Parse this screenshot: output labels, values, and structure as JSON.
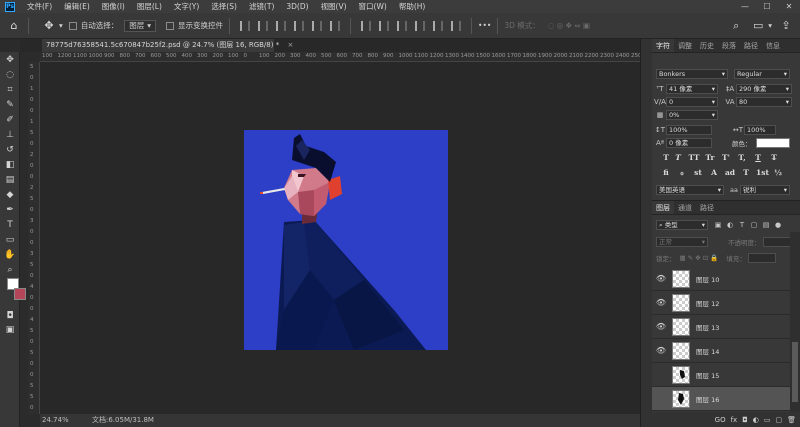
{
  "app": {
    "logo": "Ps"
  },
  "menu": [
    "文件(F)",
    "编辑(E)",
    "图像(I)",
    "图层(L)",
    "文字(Y)",
    "选择(S)",
    "滤镜(T)",
    "3D(D)",
    "视图(V)",
    "窗口(W)",
    "帮助(H)"
  ],
  "window_buttons": [
    "—",
    "☐",
    "✕"
  ],
  "options": {
    "auto_select_label": "自动选择：",
    "auto_select_value": "图层",
    "show_transform_label": "显示变换控件",
    "mode_3d_label": "3D 模式：",
    "more": "•••"
  },
  "document": {
    "tab_title": "78775d76358541.5c670847b25f2.psd @ 24.7% (图层 16, RGB/8) *",
    "zoom": "24.74%",
    "doc_info": "文档:6.05M/31.8M"
  },
  "ruler": {
    "top": [
      "100",
      "1200",
      "1100",
      "1000",
      "900",
      "800",
      "700",
      "600",
      "500",
      "400",
      "300",
      "200",
      "100",
      "0",
      "100",
      "200",
      "300",
      "400",
      "500",
      "600",
      "700",
      "800",
      "900",
      "1000",
      "1100",
      "1200",
      "1300",
      "1400",
      "1500",
      "1600",
      "1700",
      "1800",
      "1900",
      "2000",
      "2100",
      "2200",
      "2300",
      "2400",
      "2500",
      "2600"
    ],
    "left": [
      "5",
      "0",
      "1",
      "0",
      "0",
      "1",
      "5",
      "0",
      "2",
      "0",
      "0",
      "2",
      "5",
      "0",
      "3",
      "0",
      "0",
      "3",
      "5",
      "0",
      "4",
      "0",
      "0",
      "4",
      "5",
      "0",
      "5",
      "0",
      "0",
      "5",
      "5",
      "0"
    ]
  },
  "character_panel": {
    "tabs": [
      "字符",
      "调整",
      "历史",
      "段落",
      "路径",
      "信息"
    ],
    "font_family": "Bonkers",
    "font_style": "Regular",
    "font_size": "41 像素",
    "leading": "290 像素",
    "kerning": "0",
    "tracking": "80",
    "scale_percent": "0%",
    "vertical_scale": "100%",
    "horizontal_scale": "100%",
    "baseline": "0 像素",
    "color_label": "颜色：",
    "color": "#ffffff",
    "type_buttons": [
      "T",
      "T",
      "TT",
      "Tr",
      "T'",
      "T,",
      "T",
      "T̶"
    ],
    "ligature_buttons": [
      "fi",
      "ℴ",
      "st",
      "A",
      "ad",
      "T",
      "1st",
      "½"
    ],
    "language": "美国英语",
    "aa_icon": "aa",
    "antialias": "锐利"
  },
  "layers_panel": {
    "tabs": [
      "图层",
      "通道",
      "路径"
    ],
    "filter_label": "类型",
    "blend_mode": "正常",
    "opacity_label": "不透明度：",
    "lock_label": "锁定：",
    "fill_label": "填充：",
    "layers": [
      {
        "name": "图层 10",
        "visible": true,
        "selected": false
      },
      {
        "name": "图层 12",
        "visible": true,
        "selected": false
      },
      {
        "name": "图层 13",
        "visible": true,
        "selected": false
      },
      {
        "name": "图层 14",
        "visible": true,
        "selected": false
      },
      {
        "name": "图层 15",
        "visible": false,
        "selected": false
      },
      {
        "name": "图层 16",
        "visible": false,
        "selected": true
      }
    ],
    "footer_icons": [
      "GO",
      "fx",
      "◘",
      "◐",
      "▭",
      "▢",
      "🗑"
    ]
  },
  "colors": {
    "foreground": "#ffffff",
    "background": "#b5465a",
    "artwork_bg": "#2d3ec7"
  }
}
